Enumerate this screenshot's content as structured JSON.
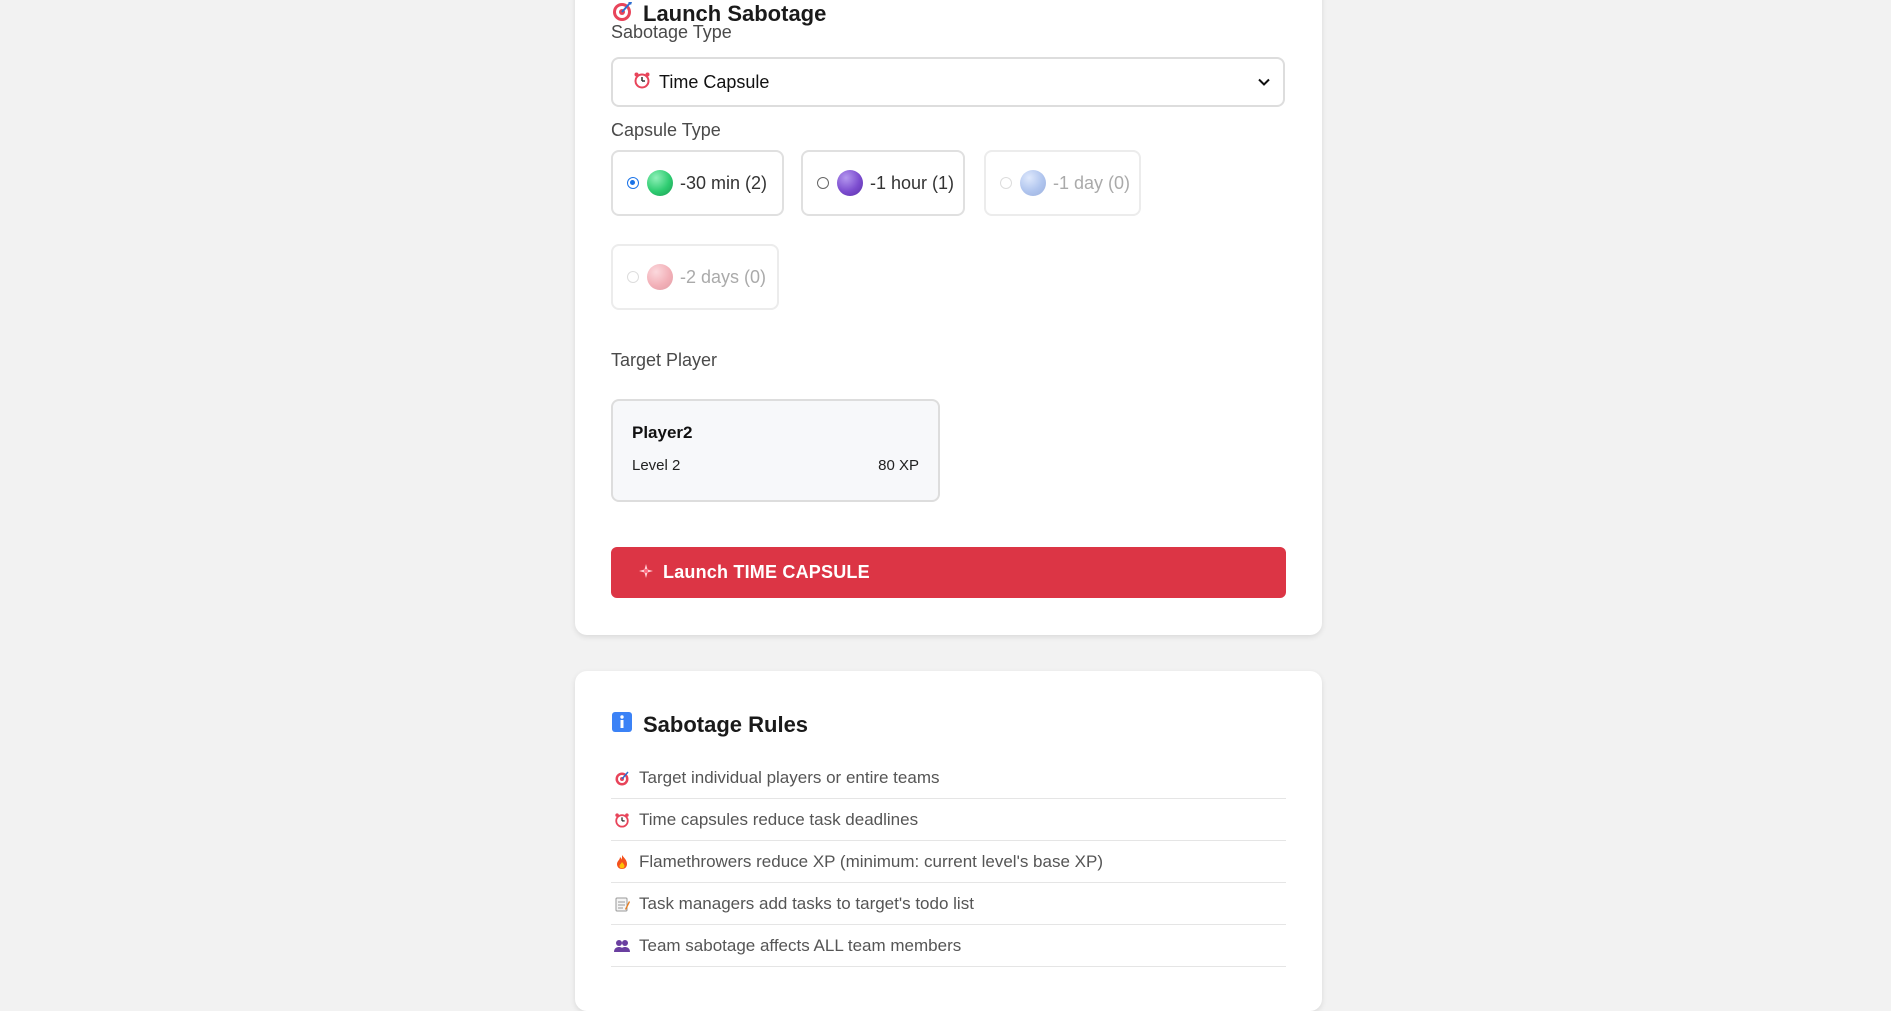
{
  "launch": {
    "title": "Launch Sabotage",
    "title_icon": "target-icon",
    "sabotage_type_label": "Sabotage Type",
    "sabotage_type_value": "Time Capsule",
    "sabotage_type_icon": "alarm-clock-icon",
    "capsule_type_label": "Capsule Type",
    "capsules": [
      {
        "label": "-30 min (2)",
        "selected": true,
        "disabled": false,
        "color": "#2ecc71"
      },
      {
        "label": "-1 hour (1)",
        "selected": false,
        "disabled": false,
        "color": "#7c4dcf"
      },
      {
        "label": "-1 day (0)",
        "selected": false,
        "disabled": true,
        "color": "#6f95e0"
      },
      {
        "label": "-2 days (0)",
        "selected": false,
        "disabled": true,
        "color": "#e8707e"
      }
    ],
    "target_label": "Target Player",
    "target": {
      "name": "Player2",
      "level": "Level 2",
      "xp": "80 XP"
    },
    "button_label": "Launch TIME CAPSULE",
    "button_icon": "sparkle-icon",
    "button_color": "#dc3545"
  },
  "rules": {
    "title": "Sabotage Rules",
    "title_icon": "info-icon",
    "items": [
      {
        "icon": "target-icon",
        "text": "Target individual players or entire teams"
      },
      {
        "icon": "alarm-clock-icon",
        "text": "Time capsules reduce task deadlines"
      },
      {
        "icon": "fire-icon",
        "text": "Flamethrowers reduce XP (minimum: current level's base XP)"
      },
      {
        "icon": "memo-icon",
        "text": "Task managers add tasks to target's todo list"
      },
      {
        "icon": "team-icon",
        "text": "Team sabotage affects ALL team members"
      }
    ]
  }
}
